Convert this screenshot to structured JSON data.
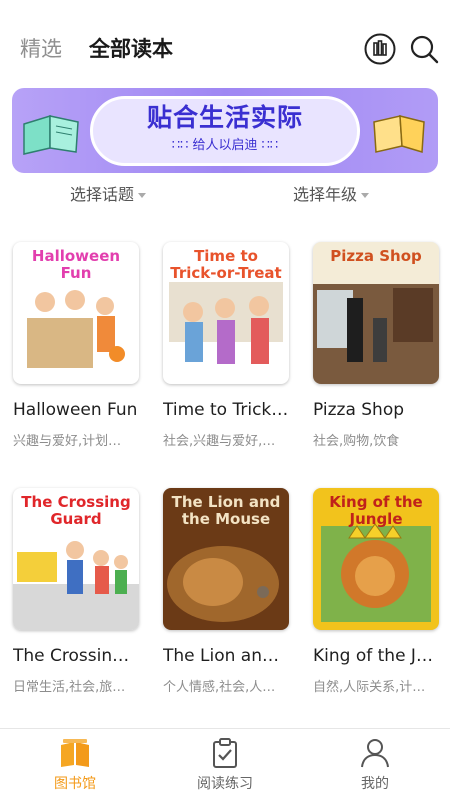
{
  "header": {
    "tabs": [
      {
        "label": "精选",
        "active": false
      },
      {
        "label": "全部读本",
        "active": true
      }
    ],
    "icons": [
      "bookshelf-stats-icon",
      "search-icon"
    ]
  },
  "banner": {
    "headline": "贴合生活实际",
    "subline": "∷∷ 给人以启迪 ∷∷"
  },
  "filters": {
    "topic": "选择话题",
    "grade": "选择年级"
  },
  "books": [
    {
      "cover_text": "Halloween Fun",
      "title": "Halloween Fun",
      "tags": "兴趣与爱好,计划…",
      "cover_bg": "#ffffff",
      "cover_color": "#e23fae"
    },
    {
      "cover_text": "Time to Trick-or-Treat",
      "title": "Time to Trick…",
      "tags": "社会,兴趣与爱好,…",
      "cover_bg": "#ffffff",
      "cover_color": "#e8532c"
    },
    {
      "cover_text": "Pizza Shop",
      "title": "Pizza Shop",
      "tags": "社会,购物,饮食",
      "cover_bg": "#f4ecd7",
      "cover_color": "#d0501f"
    },
    {
      "cover_text": "The Crossing Guard",
      "title": "The Crossing…",
      "tags": "日常生活,社会,旅…",
      "cover_bg": "#ffffff",
      "cover_color": "#e0262a"
    },
    {
      "cover_text": "The Lion and the Mouse",
      "title": "The Lion and …",
      "tags": "个人情感,社会,人…",
      "cover_bg": "#6b3a16",
      "cover_color": "#f3e3c4"
    },
    {
      "cover_text": "King of the Jungle",
      "title": "King of the J…",
      "tags": "自然,人际关系,计…",
      "cover_bg": "#f2c31c",
      "cover_color": "#c0221b"
    }
  ],
  "bottom_nav": [
    {
      "label": "图书馆",
      "icon": "books-icon",
      "active": true
    },
    {
      "label": "阅读练习",
      "icon": "clipboard-check-icon",
      "active": false
    },
    {
      "label": "我的",
      "icon": "person-icon",
      "active": false
    }
  ],
  "colors": {
    "accent": "#f39a1a",
    "banner": "#a68ef4",
    "banner_text": "#3a2fd1"
  }
}
